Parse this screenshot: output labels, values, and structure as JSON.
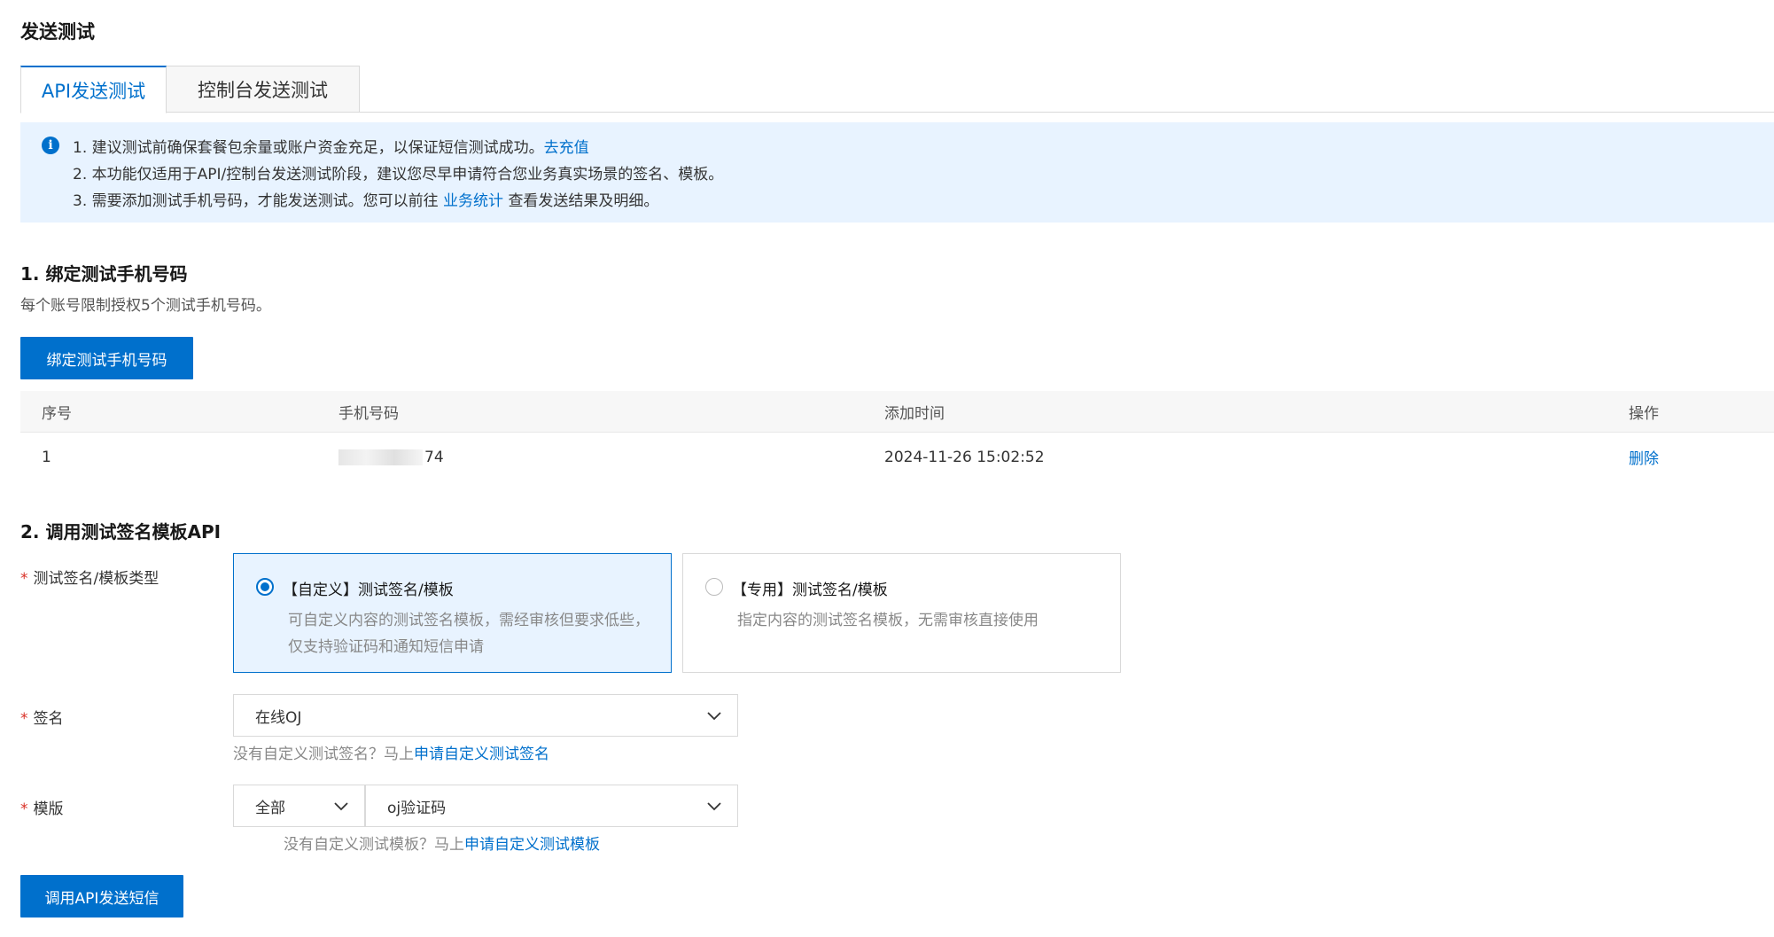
{
  "page_title": "发送测试",
  "tabs": [
    {
      "label": "API发送测试",
      "active": true
    },
    {
      "label": "控制台发送测试",
      "active": false
    }
  ],
  "notice": {
    "line1_text": "1. 建议测试前确保套餐包余量或账户资金充足，以保证短信测试成功。",
    "line1_link": "去充值",
    "line2_text": "2. 本功能仅适用于API/控制台发送测试阶段，建议您尽早申请符合您业务真实场景的签名、模板。",
    "line3_text_before": "3. 需要添加测试手机号码，才能发送测试。您可以前往",
    "line3_link": "业务统计",
    "line3_text_after": "查看发送结果及明细。"
  },
  "section1": {
    "title": "1. 绑定测试手机号码",
    "description": "每个账号限制授权5个测试手机号码。",
    "bind_button": "绑定测试手机号码",
    "table": {
      "headers": {
        "index": "序号",
        "phone": "手机号码",
        "added_time": "添加时间",
        "action": "操作"
      },
      "rows": [
        {
          "index": "1",
          "phone_suffix": "74",
          "added_time": "2024-11-26 15:02:52",
          "action": "删除"
        }
      ]
    }
  },
  "section2": {
    "title": "2. 调用测试签名模板API",
    "type_label": "测试签名/模板类型",
    "required_mark": "*",
    "card_custom": {
      "title": "【自定义】测试签名/模板",
      "desc": "可自定义内容的测试签名模板，需经审核但要求低些，仅支持验证码和通知短信申请",
      "selected": true
    },
    "card_special": {
      "title": "【专用】测试签名/模板",
      "desc": "指定内容的测试签名模板，无需审核直接使用",
      "selected": false
    },
    "sign_label": "签名",
    "sign_value": "在线OJ",
    "sign_hint_text": "没有自定义测试签名？马上",
    "sign_hint_link": "申请自定义测试签名",
    "template_label": "模版",
    "template_category": "全部",
    "template_value": "oj验证码",
    "template_hint_text": "没有自定义测试模板？马上",
    "template_hint_link": "申请自定义测试模板",
    "send_button": "调用API发送短信"
  },
  "colors": {
    "accent": "#0070cc",
    "notice_bg": "#e8f3ff",
    "required": "#d93026"
  }
}
